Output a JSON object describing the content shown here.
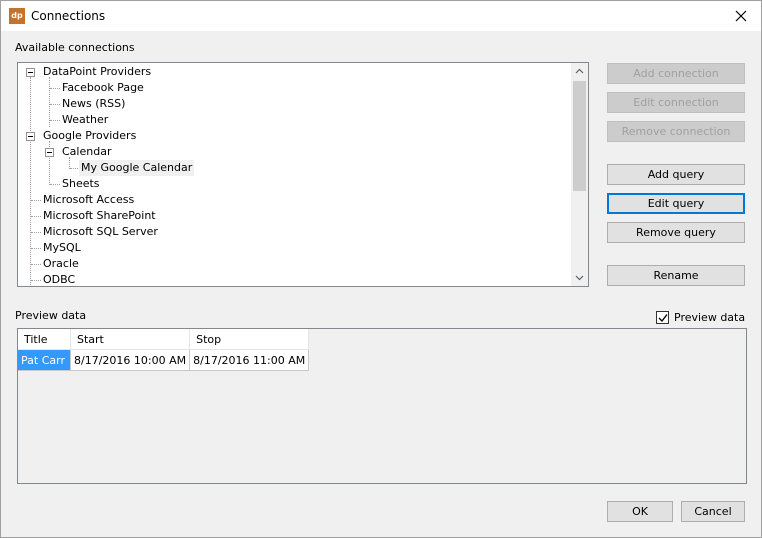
{
  "window": {
    "title": "Connections",
    "app_icon_text": "dp"
  },
  "labels": {
    "available": "Available connections",
    "preview": "Preview data"
  },
  "tree": {
    "nodes": [
      {
        "label": "DataPoint Providers"
      },
      {
        "label": "Facebook Page"
      },
      {
        "label": "News (RSS)"
      },
      {
        "label": "Weather"
      },
      {
        "label": "Google Providers"
      },
      {
        "label": "Calendar"
      },
      {
        "label": "My Google Calendar",
        "selected": true
      },
      {
        "label": "Sheets"
      },
      {
        "label": "Microsoft Access"
      },
      {
        "label": "Microsoft SharePoint"
      },
      {
        "label": "Microsoft SQL Server"
      },
      {
        "label": "MySQL"
      },
      {
        "label": "Oracle"
      },
      {
        "label": "ODBC"
      }
    ]
  },
  "buttons": {
    "add_connection": "Add connection",
    "edit_connection": "Edit connection",
    "remove_connection": "Remove connection",
    "add_query": "Add query",
    "edit_query": "Edit query",
    "remove_query": "Remove query",
    "rename": "Rename",
    "ok": "OK",
    "cancel": "Cancel"
  },
  "preview_checkbox": {
    "label": "Preview data",
    "checked": true
  },
  "grid": {
    "columns": [
      "Title",
      "Start",
      "Stop"
    ],
    "rows": [
      [
        "Pat Carr",
        "8/17/2016 10:00 AM",
        "8/17/2016 11:00 AM"
      ]
    ]
  },
  "colors": {
    "accent": "#0078d7",
    "selection": "#3399ff",
    "app_icon": "#c7722b"
  }
}
